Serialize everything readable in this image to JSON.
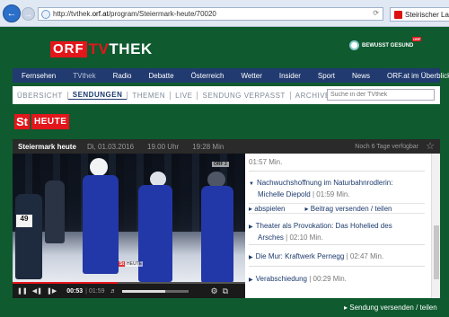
{
  "browser": {
    "url_prefix": "http://tvthek.",
    "url_domain": "orf.at",
    "url_path": "/program/Steiermark-heute/70020",
    "tab_title": "Steirischer Lan"
  },
  "header": {
    "brand_orf": "ORF",
    "brand_tv": "TV",
    "brand_thek": "THEK",
    "gesund_label": "BEWUSST GESUND",
    "gesund_badge": "ORF"
  },
  "main_nav": [
    {
      "label": "Fernsehen"
    },
    {
      "label": "TVthek"
    },
    {
      "label": "Radio"
    },
    {
      "label": "Debatte"
    },
    {
      "label": "Österreich"
    },
    {
      "label": "Wetter"
    },
    {
      "label": "Insider"
    },
    {
      "label": "Sport"
    },
    {
      "label": "News"
    },
    {
      "label": "ORF.at im Überblick"
    }
  ],
  "sub_nav": [
    {
      "label": "ÜBERSICHT"
    },
    {
      "label": "SENDUNGEN"
    },
    {
      "label": "THEMEN"
    },
    {
      "label": "LIVE"
    },
    {
      "label": "SENDUNG VERPASST"
    },
    {
      "label": "ARCHIVE"
    }
  ],
  "search": {
    "placeholder": "Suche in der TVthek"
  },
  "channel_logo": {
    "st": "St",
    "heute": "HEUTE"
  },
  "episode": {
    "title": "Steiermark heute",
    "date": "Di, 01.03.2016",
    "time": "19.00 Uhr",
    "duration": "19:28 Min",
    "availability": "Noch 6 Tage verfügbar"
  },
  "player": {
    "current_time": "00:53",
    "separator": "|",
    "total_time": "01:59",
    "progress": 0.45,
    "volume": 0.65,
    "bib_number": "49",
    "channel_bug": "ORF 2",
    "watermark_st": "St",
    "watermark_heute": "HEUTE"
  },
  "chapters": {
    "cut_duration": "01:57 Min.",
    "expanded": {
      "title_line1": "Nachwuchshoffnung im Naturbahnrodlerin:",
      "title_line2": "Michelle Diepold",
      "duration": "| 01:59 Min.",
      "play_label": "abspielen",
      "share_label": "Beitrag versenden / teilen"
    },
    "items": [
      {
        "title_line1": "Theater als Provokation: Das Hohelied des",
        "title_line2": "Arsches",
        "duration": "| 02:10 Min."
      },
      {
        "title_line1": "Die Mur: Kraftwerk Pernegg",
        "title_line2": "",
        "duration": "| 02:47 Min."
      },
      {
        "title_line1": "Verabschiedung",
        "title_line2": "",
        "duration": "| 00:29 Min."
      }
    ]
  },
  "footer": {
    "share_label": "Sendung versenden / teilen"
  },
  "colors": {
    "orf_red": "#e3161b",
    "nav_blue": "#213a6f",
    "bg_green": "#0f5a2f"
  }
}
